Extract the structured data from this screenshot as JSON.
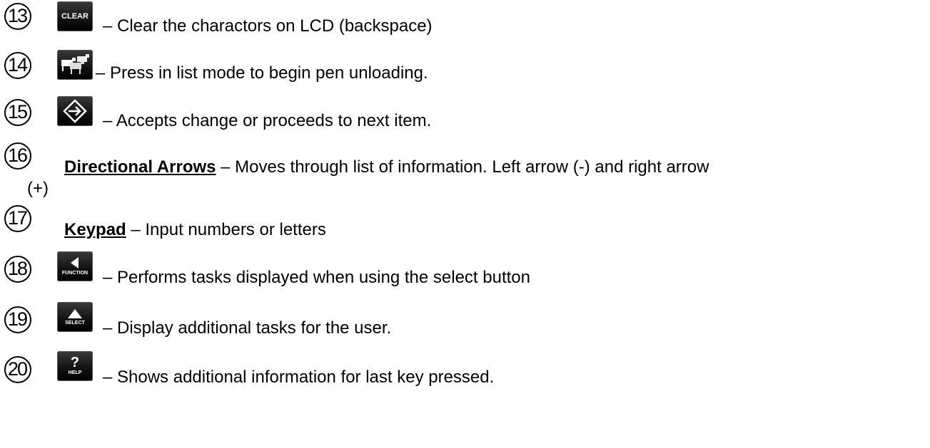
{
  "items": [
    {
      "number": "13",
      "key": "CLEAR",
      "icon": "clear-key-icon",
      "text": "– Clear the charactors on LCD (backspace)"
    },
    {
      "number": "14",
      "key": "",
      "icon": "cattle-unload-key-icon",
      "text": "– Press in list mode to begin pen unloading."
    },
    {
      "number": "15",
      "key": "",
      "icon": "enter-arrow-key-icon",
      "text": "– Accepts change or proceeds to next item."
    },
    {
      "number": "16",
      "term": "Directional Arrows",
      "text": " – Moves through list of information. Left arrow (-) and right arrow",
      "continuation": "(+)"
    },
    {
      "number": "17",
      "term": "Keypad",
      "text": " – Input numbers or letters"
    },
    {
      "number": "18",
      "key": "FUNCTION",
      "icon": "function-key-icon",
      "text": "– Performs tasks displayed when using the select button"
    },
    {
      "number": "19",
      "key": "SELECT",
      "icon": "select-key-icon",
      "text": "– Display additional tasks for the user."
    },
    {
      "number": "20",
      "key": "HELP",
      "icon": "help-key-icon",
      "text": "– Shows additional information for last key pressed."
    }
  ]
}
